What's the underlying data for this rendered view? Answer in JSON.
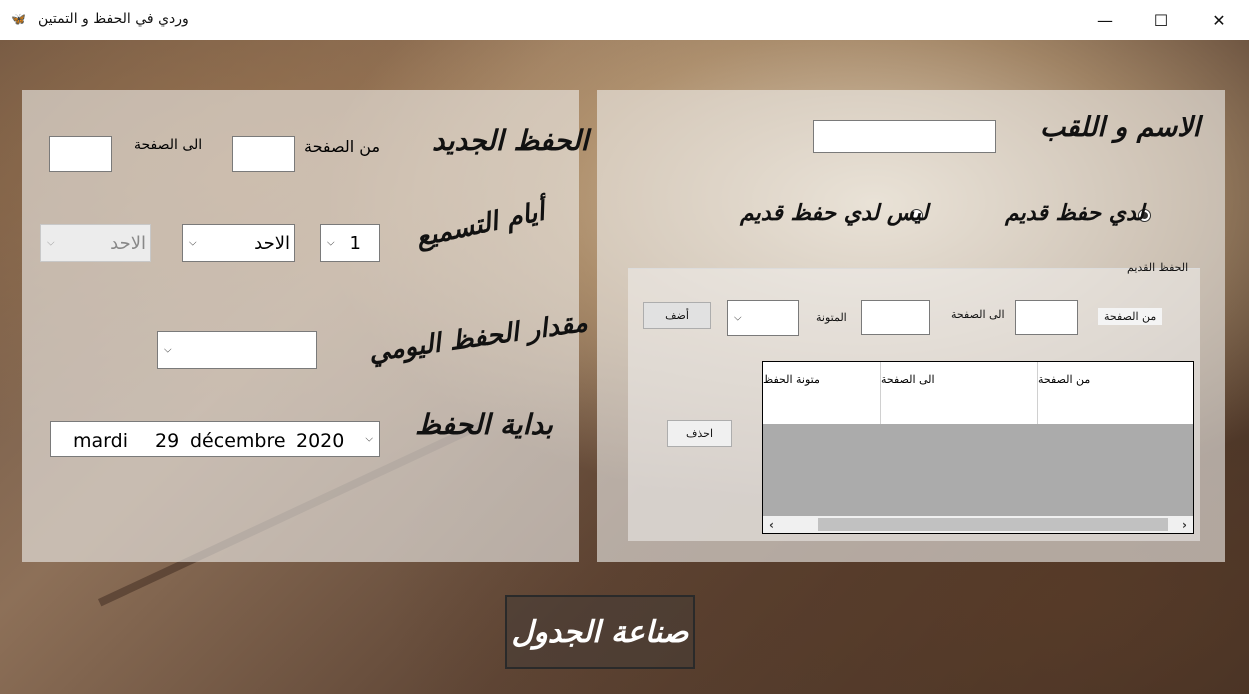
{
  "window": {
    "title": "وردي في الحفظ و التمتين",
    "minimize": "—",
    "maximize": "☐",
    "close": "✕",
    "app_icon": "🦋"
  },
  "right_panel": {
    "name_label": "الاسم و اللقب",
    "name_value": "",
    "radio_has_old": "لدي حفظ قديم",
    "radio_no_old": "ليس لدي حفظ قديم",
    "radio_selected": "has_old",
    "old_group": {
      "title": "الحفظ القديم",
      "from_page_label": "من الصفحة",
      "to_page_label": "الى الصفحة",
      "mutun_label": "المتونة",
      "add_button": "أضف",
      "delete_button": "احذف",
      "table": {
        "columns": [
          "من الصفحة",
          "الى الصفحة",
          "متونة الحفظ"
        ],
        "rows": [
          [
            "",
            "",
            ""
          ]
        ]
      }
    }
  },
  "left_panel": {
    "new_memo_label": "الحفظ الجديد",
    "from_page_label": "من الصفحة",
    "to_page_label": "الى الصفحة",
    "recitation_days_label": "أيام التسميع",
    "days_count": "1",
    "day_start": "الاحد",
    "day_end": "الاحد",
    "daily_amount_label": "مقدار الحفظ اليومي",
    "daily_amount_value": "",
    "start_label": "بداية الحفظ",
    "start_date": {
      "weekday": "mardi",
      "day": "29",
      "month": "décembre",
      "year": "2020"
    }
  },
  "make_table_button": "صناعة الجدول"
}
